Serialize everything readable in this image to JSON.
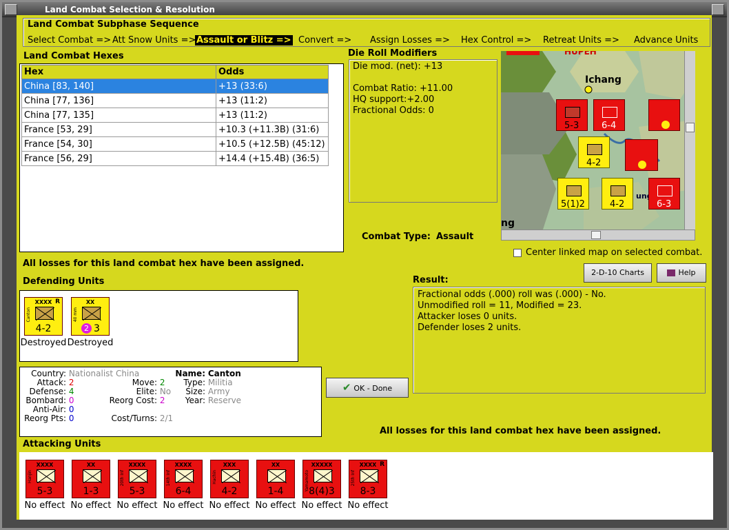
{
  "window": {
    "title": "Land Combat Selection & Resolution"
  },
  "subphase": {
    "title": "Land Combat Subphase Sequence",
    "steps": [
      "Select Combat =>",
      "Att Snow Units =>",
      "Assault or Blitz =>",
      "Convert =>",
      "Assign Losses =>",
      "Hex Control =>",
      "Retreat Units =>",
      "Advance Units"
    ],
    "active_index": 2
  },
  "hexes": {
    "title": "Land Combat Hexes",
    "columns": [
      "Hex",
      "Odds"
    ],
    "rows": [
      {
        "hex": "China [83, 140]",
        "odds": "+13 (33:6)"
      },
      {
        "hex": "China [77, 136]",
        "odds": "+13 (11:2)"
      },
      {
        "hex": "China [77, 135]",
        "odds": "+13 (11:2)"
      },
      {
        "hex": "France [53, 29]",
        "odds": "+10.3 (+11.3B) (31:6)"
      },
      {
        "hex": "France [54, 30]",
        "odds": "+10.5 (+12.5B) (45:12)"
      },
      {
        "hex": "France [56, 29]",
        "odds": "+14.4 (+15.4B) (36:5)"
      }
    ],
    "selected_index": 0
  },
  "modifiers": {
    "title": "Die Roll Modifiers",
    "lines": [
      "Die mod. (net): +13",
      "",
      "Combat Ratio: +11.00",
      "HQ support:+2.00",
      "Fractional Odds: 0"
    ]
  },
  "combat_type": {
    "label": "Combat Type:",
    "value": "Assault"
  },
  "map": {
    "labels": [
      "HUPEH",
      "Ichang",
      "ng",
      "ung"
    ],
    "center_checkbox": "Center linked map on selected combat.",
    "center_checked": false
  },
  "losses_msg_top": "All losses for this land combat hex have been assigned.",
  "losses_msg_bottom": "All losses for this land combat hex have been assigned.",
  "buttons": {
    "charts": "2-D-10 Charts",
    "help": "Help",
    "ok": "OK - Done"
  },
  "result": {
    "title": "Result:",
    "lines": [
      "Fractional odds (.000) roll was (.000)  -  No.",
      "Unmodified roll = 11, Modified = 23.",
      "Attacker loses 0 units.",
      "Defender loses 2 units."
    ]
  },
  "defending": {
    "title": "Defending Units",
    "units": [
      {
        "size": "XXXX",
        "side": "Canton",
        "strength": "4-2",
        "status": "Destroyed",
        "color": "#ffee10"
      },
      {
        "size": "XX",
        "side": "40 mm",
        "strength": "3",
        "extra": "2",
        "status": "Destroyed",
        "color": "#ffee10"
      }
    ]
  },
  "details": {
    "country_label": "Country:",
    "country": "Nationalist China",
    "attack_label": "Attack:",
    "attack": "2",
    "defense_label": "Defense:",
    "defense": "4",
    "bombard_label": "Bombard:",
    "bombard": "0",
    "antiair_label": "Anti-Air:",
    "antiair": "0",
    "reorg_label": "Reorg Pts:",
    "reorg": "0",
    "move_label": "Move:",
    "move": "2",
    "elite_label": "Elite:",
    "elite": "No",
    "reorgcost_label": "Reorg Cost:",
    "reorgcost": "2",
    "costturns_label": "Cost/Turns:",
    "costturns": "2/1",
    "name_label": "Name:",
    "name": "Canton",
    "type_label": "Type:",
    "type": "Militia",
    "sizel_label": "Size:",
    "size": "Army",
    "year_label": "Year:",
    "year": "Reserve"
  },
  "attacking": {
    "title": "Attacking Units",
    "units": [
      {
        "size": "XXXX",
        "side": "Hanjin",
        "strength": "5-3",
        "status": "No effect"
      },
      {
        "size": "XX",
        "side": "",
        "strength": "1-3",
        "status": "No effect"
      },
      {
        "size": "XXXX",
        "side": "20th Inf",
        "strength": "5-3",
        "status": "No effect"
      },
      {
        "size": "XXXX",
        "side": "14th Inf",
        "strength": "6-4",
        "status": "No effect"
      },
      {
        "size": "XXX",
        "side": "Hachin",
        "strength": "4-2",
        "status": "No effect"
      },
      {
        "size": "XX",
        "side": "",
        "strength": "1-4",
        "status": "No effect"
      },
      {
        "size": "XXXXX",
        "side": "Yamamoto",
        "strength": "8(4)3",
        "status": "No effect"
      },
      {
        "size": "XXXX",
        "side": "25th Inf",
        "strength": "8-3",
        "status": "No effect"
      }
    ]
  },
  "colors": {
    "panel": "#d6d81e",
    "selected": "#2b83e0",
    "red_unit": "#e81010",
    "yellow_unit": "#ffee10"
  }
}
